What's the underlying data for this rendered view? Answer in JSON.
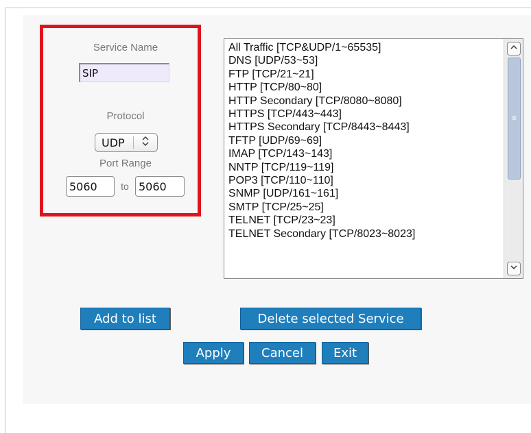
{
  "service_form": {
    "service_name_label": "Service Name",
    "service_name_value": "SIP",
    "protocol_label": "Protocol",
    "protocol_value": "UDP",
    "port_range_label": "Port Range",
    "port_start": "5060",
    "port_to_label": "to",
    "port_end": "5060"
  },
  "service_list": {
    "items": [
      "All Traffic [TCP&UDP/1~65535]",
      "DNS [UDP/53~53]",
      "FTP [TCP/21~21]",
      "HTTP [TCP/80~80]",
      "HTTP Secondary [TCP/8080~8080]",
      "HTTPS [TCP/443~443]",
      "HTTPS Secondary [TCP/8443~8443]",
      "TFTP [UDP/69~69]",
      "IMAP [TCP/143~143]",
      "NNTP [TCP/119~119]",
      "POP3 [TCP/110~110]",
      "SNMP [UDP/161~161]",
      "SMTP [TCP/25~25]",
      "TELNET [TCP/23~23]",
      "TELNET Secondary [TCP/8023~8023]"
    ]
  },
  "buttons": {
    "add_to_list": "Add to list",
    "delete_selected": "Delete selected Service",
    "apply": "Apply",
    "cancel": "Cancel",
    "exit": "Exit"
  },
  "icons": {
    "protocol_dropdown": "up-down-chevron-icon",
    "scroll_up": "scroll-up-arrow-icon",
    "scroll_down": "scroll-down-arrow-icon"
  },
  "colors": {
    "button_bg": "#1f7fbd",
    "highlight_border": "#e0141e",
    "name_input_bg": "#eeeafc"
  }
}
